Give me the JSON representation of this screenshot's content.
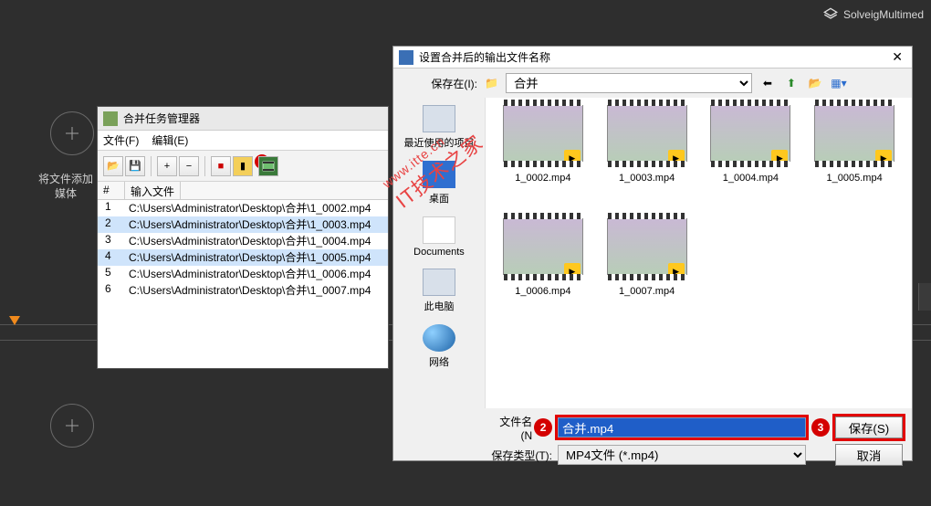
{
  "brand": "SolveigMultimed",
  "sidebar_hint": "将文件添加\n媒体",
  "task_window": {
    "title": "合并任务管理器",
    "menu": {
      "file": "文件(F)",
      "edit": "编辑(E)"
    },
    "marker1": "1",
    "header": {
      "num": "#",
      "path": "输入文件"
    },
    "rows": [
      {
        "n": "1",
        "path": "C:\\Users\\Administrator\\Desktop\\合并\\1_0002.mp4",
        "sel": false
      },
      {
        "n": "2",
        "path": "C:\\Users\\Administrator\\Desktop\\合并\\1_0003.mp4",
        "sel": true
      },
      {
        "n": "3",
        "path": "C:\\Users\\Administrator\\Desktop\\合并\\1_0004.mp4",
        "sel": false
      },
      {
        "n": "4",
        "path": "C:\\Users\\Administrator\\Desktop\\合并\\1_0005.mp4",
        "sel": true
      },
      {
        "n": "5",
        "path": "C:\\Users\\Administrator\\Desktop\\合并\\1_0006.mp4",
        "sel": false
      },
      {
        "n": "6",
        "path": "C:\\Users\\Administrator\\Desktop\\合并\\1_0007.mp4",
        "sel": false
      }
    ]
  },
  "save_dialog": {
    "title": "设置合并后的输出文件名称",
    "save_in_label": "保存在(I):",
    "save_in_value": "合并",
    "places": {
      "recent": "最近使用的项目",
      "desktop": "桌面",
      "documents": "Documents",
      "computer": "此电脑",
      "network": "网络"
    },
    "files": [
      "1_0002.mp4",
      "1_0003.mp4",
      "1_0004.mp4",
      "1_0005.mp4",
      "1_0006.mp4",
      "1_0007.mp4"
    ],
    "filename_label": "文件名(N",
    "filename_value": "合并.mp4",
    "filetype_label": "保存类型(T):",
    "filetype_value": "MP4文件 (*.mp4)",
    "save_btn": "保存(S)",
    "cancel_btn": "取消",
    "marker2": "2",
    "marker3": "3"
  },
  "watermark": {
    "line1": "IT技术之家",
    "line2": "www.itte.cn"
  }
}
